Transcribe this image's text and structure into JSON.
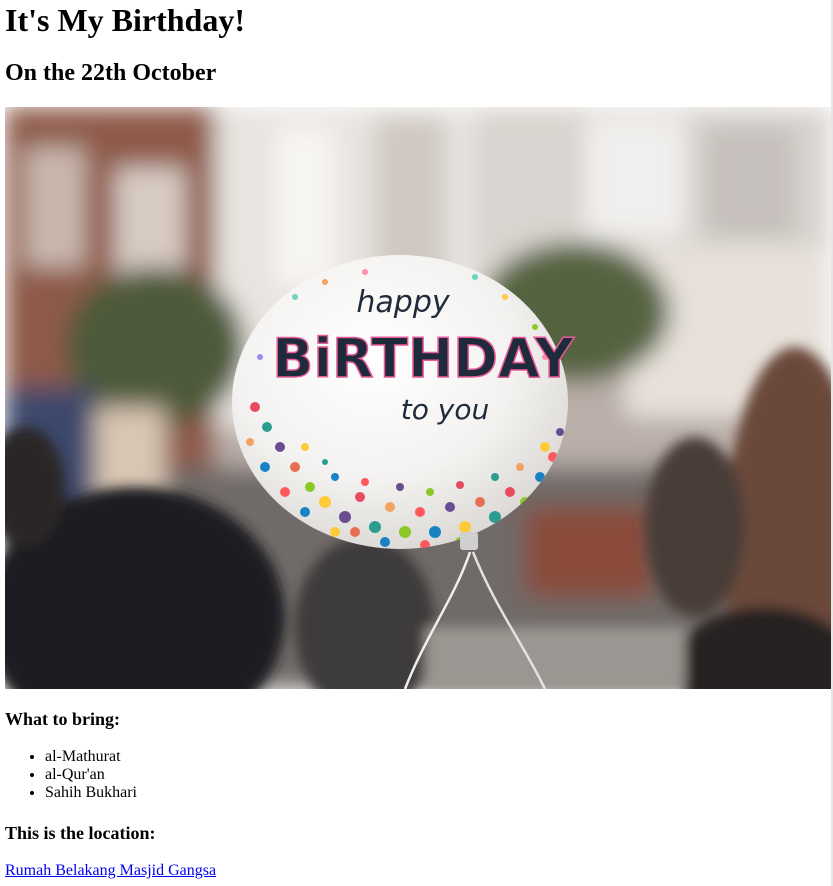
{
  "heading": "It's My Birthday!",
  "subheading": "On the 22th October",
  "photo": {
    "balloon_lines": [
      "happy",
      "BiRTHDAY",
      "to you"
    ]
  },
  "bring": {
    "title": "What to bring:",
    "items": [
      "al-Mathurat",
      "al-Qur'an",
      "Sahih Bukhari"
    ]
  },
  "location": {
    "title": "This is the location:",
    "link_text": "Rumah Belakang Masjid Gangsa"
  },
  "colors": {
    "link": "#0000ee",
    "text": "#000000",
    "background": "#ffffff"
  }
}
